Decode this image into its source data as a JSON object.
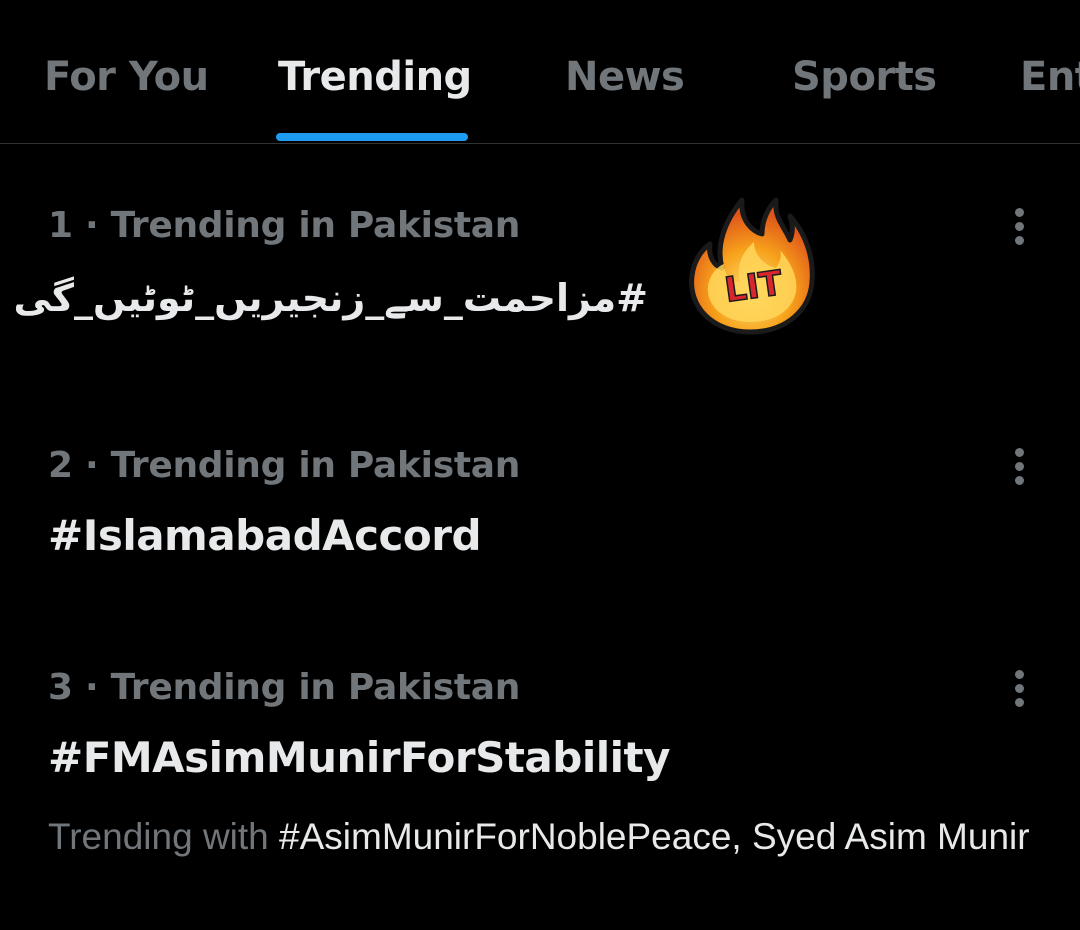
{
  "tabs": [
    {
      "label": "For You",
      "active": false
    },
    {
      "label": "Trending",
      "active": true
    },
    {
      "label": "News",
      "active": false
    },
    {
      "label": "Sports",
      "active": false
    },
    {
      "label": "Ent",
      "active": false
    }
  ],
  "trends": [
    {
      "meta": "1 · Trending in Pakistan",
      "title": "#مزاحمت_سے_زنجیریں_ٹوٹیں_گی",
      "sticker": {
        "icon": "fire-icon",
        "text": "LIT"
      }
    },
    {
      "meta": "2 · Trending in Pakistan",
      "title": "#IslamabadAccord"
    },
    {
      "meta": "3 · Trending in Pakistan",
      "title": "#FMAsimMunirForStability",
      "context_prefix": "Trending with ",
      "context_related": "#AsimMunirForNoblePeace, Syed Asim Munir"
    }
  ],
  "colors": {
    "background": "#000000",
    "text_primary": "#e7e9ea",
    "text_secondary": "#71767b",
    "accent": "#1d9bf0",
    "divider": "#2f3336"
  },
  "icons": {
    "more": "more-vertical-icon"
  }
}
